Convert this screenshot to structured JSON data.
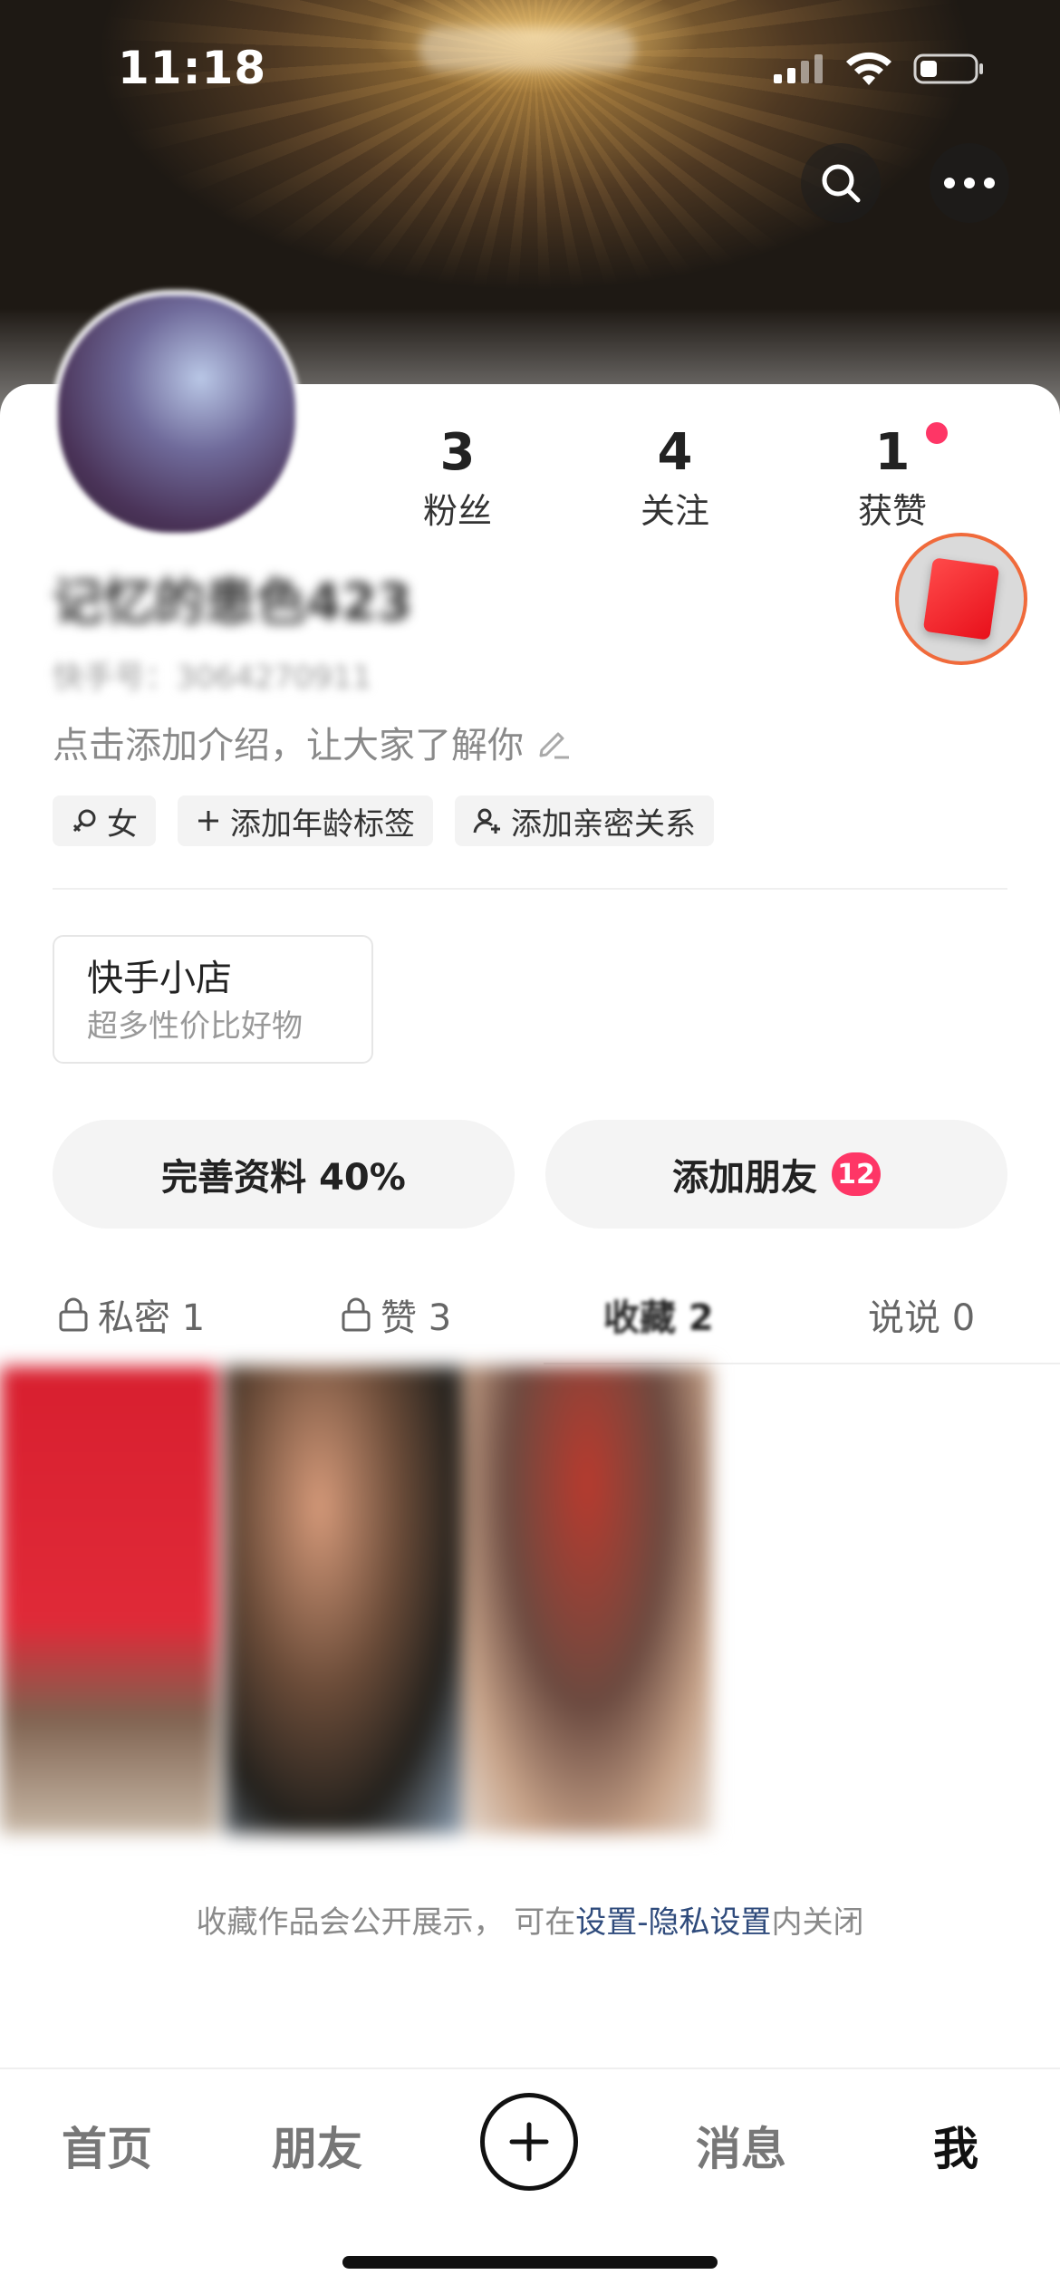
{
  "status_bar": {
    "time": "11:18"
  },
  "profile": {
    "username": "记忆的患色423",
    "user_id": "快手号：3064270911",
    "intro_placeholder": "点击添加介绍，让大家了解你"
  },
  "stats": [
    {
      "value": "3",
      "label": "粉丝"
    },
    {
      "value": "4",
      "label": "关注"
    },
    {
      "value": "1",
      "label": "获赞"
    }
  ],
  "tags": [
    {
      "label": "女",
      "icon": "female-icon"
    },
    {
      "label": "添加年龄标签",
      "icon": "plus-icon"
    },
    {
      "label": "添加亲密关系",
      "icon": "person-add-icon"
    }
  ],
  "shop": {
    "title": "快手小店",
    "subtitle": "超多性价比好物"
  },
  "actions": {
    "complete_profile": "完善资料 40%",
    "add_friends": "添加朋友",
    "add_friends_badge": "12"
  },
  "content_tabs": [
    {
      "label": "私密 1",
      "locked": true
    },
    {
      "label": "赞 3",
      "locked": true
    },
    {
      "label": "收藏 2",
      "locked": false,
      "active": true
    },
    {
      "label": "说说 0",
      "locked": false
    }
  ],
  "privacy_note": {
    "prefix": "收藏作品会公开展示，  可在",
    "link": "设置-隐私设置",
    "suffix": "内关闭"
  },
  "bottom_nav": [
    {
      "label": "首页"
    },
    {
      "label": "朋友"
    },
    {
      "label": "消息"
    },
    {
      "label": "我",
      "active": true
    }
  ],
  "colors": {
    "accent": "#fe3666",
    "link": "#2f4b7c"
  }
}
